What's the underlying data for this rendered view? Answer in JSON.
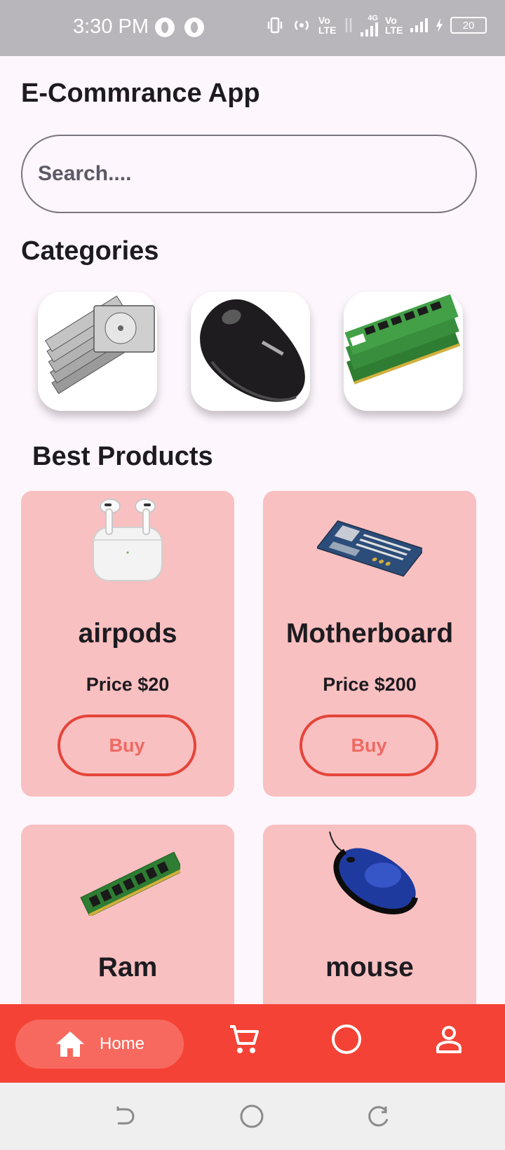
{
  "status_bar": {
    "time": "3:30 PM",
    "network_4g": "4G",
    "volte_1": "Vo LTE",
    "volte_2": "Vo LTE",
    "battery": "20"
  },
  "app": {
    "title": "E-Commrance App"
  },
  "search": {
    "placeholder": "Search...."
  },
  "categories": {
    "title": "Categories",
    "items": [
      {
        "icon": "hard-drives-image"
      },
      {
        "icon": "mouse-image"
      },
      {
        "icon": "ram-image"
      }
    ]
  },
  "best_products": {
    "title": "Best Products",
    "items": [
      {
        "name": "airpods",
        "price": "Price $20",
        "buy_label": "Buy",
        "icon": "airpods-image"
      },
      {
        "name": "Motherboard",
        "price": "Price $200",
        "buy_label": "Buy",
        "icon": "motherboard-image"
      },
      {
        "name": "Ram",
        "icon": "ram-stick-image"
      },
      {
        "name": "mouse",
        "icon": "mouse-image"
      }
    ]
  },
  "bottom_nav": {
    "home_label": "Home",
    "icons": [
      "home-icon",
      "cart-icon",
      "circle-icon",
      "person-icon"
    ]
  },
  "colors": {
    "nav_bar": "#f44336",
    "nav_active_pill": "#f7695e",
    "card_bg": "#f9c0c1",
    "buy_border": "#e5453a",
    "buy_text": "#ee6a63",
    "page_bg": "#fdf6fd"
  }
}
